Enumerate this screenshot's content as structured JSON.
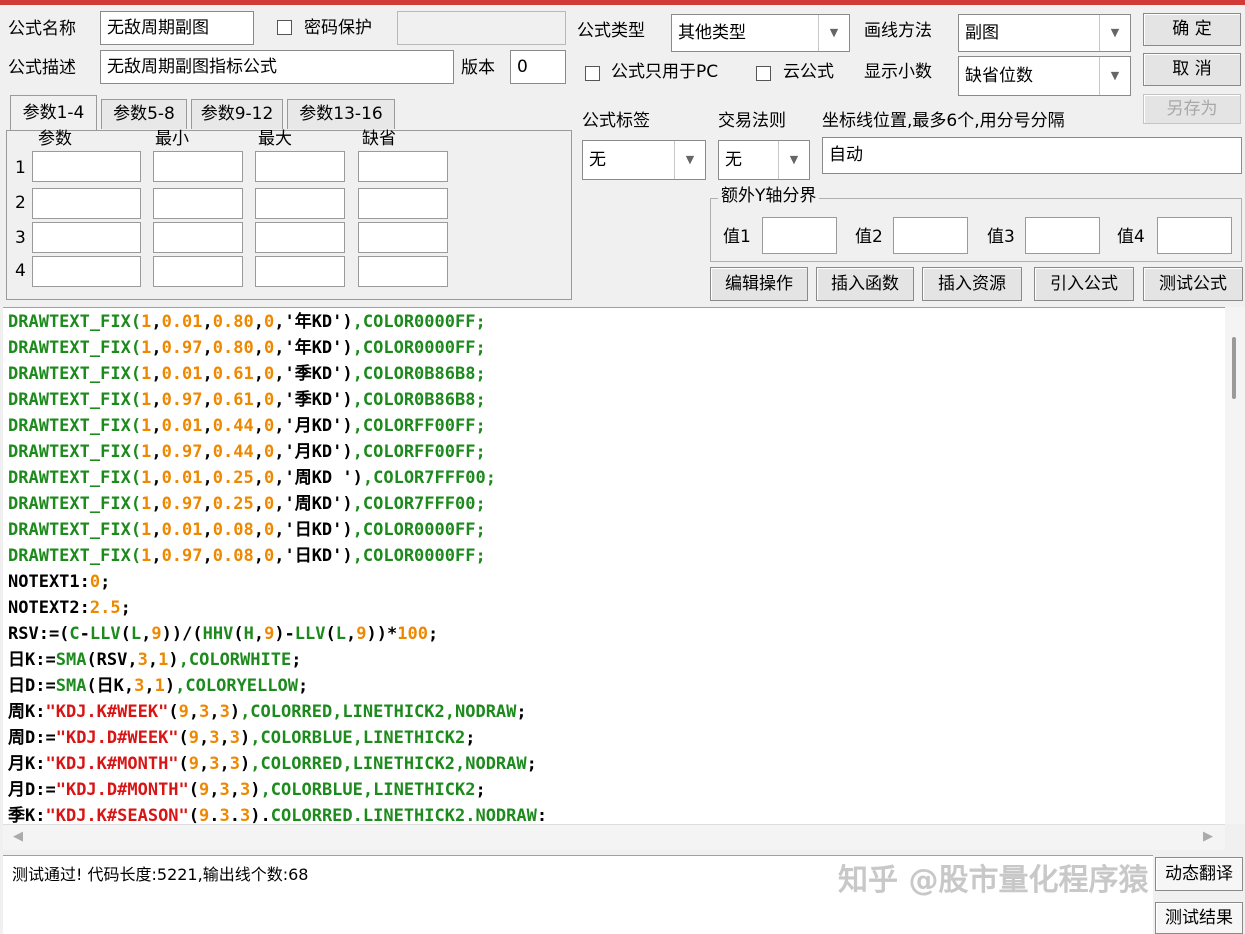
{
  "header": {
    "formula_name_label": "公式名称",
    "formula_name_value": "无敌周期副图",
    "password_label": "密码保护",
    "formula_desc_label": "公式描述",
    "formula_desc_value": "无敌周期副图指标公式",
    "version_label": "版本",
    "version_value": "0",
    "formula_type_label": "公式类型",
    "formula_type_value": "其他类型",
    "draw_method_label": "画线方法",
    "draw_method_value": "副图",
    "pc_only_label": "公式只用于PC",
    "cloud_label": "云公式",
    "decimals_label": "显示小数",
    "decimals_value": "缺省位数"
  },
  "buttons": {
    "ok": "确 定",
    "cancel": "取 消",
    "save_as": "另存为",
    "edit": "编辑操作",
    "insert_func": "插入函数",
    "insert_res": "插入资源",
    "import_formula": "引入公式",
    "test_formula": "测试公式",
    "dynamic_translate": "动态翻译",
    "test_result": "测试结果"
  },
  "params": {
    "tabs": [
      "参数1-4",
      "参数5-8",
      "参数9-12",
      "参数13-16"
    ],
    "columns": [
      "参数",
      "最小",
      "最大",
      "缺省"
    ],
    "rows": [
      "1",
      "2",
      "3",
      "4"
    ]
  },
  "options": {
    "formula_tag_label": "公式标签",
    "formula_tag_value": "无",
    "trade_rule_label": "交易法则",
    "trade_rule_value": "无",
    "coord_label": "坐标线位置,最多6个,用分号分隔",
    "coord_value": "自动",
    "y_group_label": "额外Y轴分界",
    "y_values": [
      "值1",
      "值2",
      "值3",
      "值4"
    ]
  },
  "code_lines": [
    [
      [
        "g",
        "DRAWTEXT_FIX("
      ],
      [
        "o",
        "1"
      ],
      [
        "k",
        ","
      ],
      [
        "o",
        "0.01"
      ],
      [
        "k",
        ","
      ],
      [
        "o",
        "0.80"
      ],
      [
        "k",
        ","
      ],
      [
        "o",
        "0"
      ],
      [
        "k",
        ",'年KD')"
      ],
      [
        "g",
        ",COLOR0000FF;"
      ]
    ],
    [
      [
        "g",
        "DRAWTEXT_FIX("
      ],
      [
        "o",
        "1"
      ],
      [
        "k",
        ","
      ],
      [
        "o",
        "0.97"
      ],
      [
        "k",
        ","
      ],
      [
        "o",
        "0.80"
      ],
      [
        "k",
        ","
      ],
      [
        "o",
        "0"
      ],
      [
        "k",
        ",'年KD')"
      ],
      [
        "g",
        ",COLOR0000FF;"
      ]
    ],
    [
      [
        "g",
        "DRAWTEXT_FIX("
      ],
      [
        "o",
        "1"
      ],
      [
        "k",
        ","
      ],
      [
        "o",
        "0.01"
      ],
      [
        "k",
        ","
      ],
      [
        "o",
        "0.61"
      ],
      [
        "k",
        ","
      ],
      [
        "o",
        "0"
      ],
      [
        "k",
        ",'季KD')"
      ],
      [
        "g",
        ",COLOR0B86B8;"
      ]
    ],
    [
      [
        "g",
        "DRAWTEXT_FIX("
      ],
      [
        "o",
        "1"
      ],
      [
        "k",
        ","
      ],
      [
        "o",
        "0.97"
      ],
      [
        "k",
        ","
      ],
      [
        "o",
        "0.61"
      ],
      [
        "k",
        ","
      ],
      [
        "o",
        "0"
      ],
      [
        "k",
        ",'季KD')"
      ],
      [
        "g",
        ",COLOR0B86B8;"
      ]
    ],
    [
      [
        "g",
        "DRAWTEXT_FIX("
      ],
      [
        "o",
        "1"
      ],
      [
        "k",
        ","
      ],
      [
        "o",
        "0.01"
      ],
      [
        "k",
        ","
      ],
      [
        "o",
        "0.44"
      ],
      [
        "k",
        ","
      ],
      [
        "o",
        "0"
      ],
      [
        "k",
        ",'月KD')"
      ],
      [
        "g",
        ",COLORFF00FF;"
      ]
    ],
    [
      [
        "g",
        "DRAWTEXT_FIX("
      ],
      [
        "o",
        "1"
      ],
      [
        "k",
        ","
      ],
      [
        "o",
        "0.97"
      ],
      [
        "k",
        ","
      ],
      [
        "o",
        "0.44"
      ],
      [
        "k",
        ","
      ],
      [
        "o",
        "0"
      ],
      [
        "k",
        ",'月KD')"
      ],
      [
        "g",
        ",COLORFF00FF;"
      ]
    ],
    [
      [
        "g",
        "DRAWTEXT_FIX("
      ],
      [
        "o",
        "1"
      ],
      [
        "k",
        ","
      ],
      [
        "o",
        "0.01"
      ],
      [
        "k",
        ","
      ],
      [
        "o",
        "0.25"
      ],
      [
        "k",
        ","
      ],
      [
        "o",
        "0"
      ],
      [
        "k",
        ",'周KD ')"
      ],
      [
        "g",
        ",COLOR7FFF00;"
      ]
    ],
    [
      [
        "g",
        "DRAWTEXT_FIX("
      ],
      [
        "o",
        "1"
      ],
      [
        "k",
        ","
      ],
      [
        "o",
        "0.97"
      ],
      [
        "k",
        ","
      ],
      [
        "o",
        "0.25"
      ],
      [
        "k",
        ","
      ],
      [
        "o",
        "0"
      ],
      [
        "k",
        ",'周KD')"
      ],
      [
        "g",
        ",COLOR7FFF00;"
      ]
    ],
    [
      [
        "g",
        "DRAWTEXT_FIX("
      ],
      [
        "o",
        "1"
      ],
      [
        "k",
        ","
      ],
      [
        "o",
        "0.01"
      ],
      [
        "k",
        ","
      ],
      [
        "o",
        "0.08"
      ],
      [
        "k",
        ","
      ],
      [
        "o",
        "0"
      ],
      [
        "k",
        ",'日KD')"
      ],
      [
        "g",
        ",COLOR0000FF;"
      ]
    ],
    [
      [
        "g",
        "DRAWTEXT_FIX("
      ],
      [
        "o",
        "1"
      ],
      [
        "k",
        ","
      ],
      [
        "o",
        "0.97"
      ],
      [
        "k",
        ","
      ],
      [
        "o",
        "0.08"
      ],
      [
        "k",
        ","
      ],
      [
        "o",
        "0"
      ],
      [
        "k",
        ",'日KD')"
      ],
      [
        "g",
        ",COLOR0000FF;"
      ]
    ],
    [
      [
        "k",
        "NOTEXT1:"
      ],
      [
        "o",
        "0"
      ],
      [
        "k",
        ";"
      ]
    ],
    [
      [
        "k",
        "NOTEXT2:"
      ],
      [
        "o",
        "2.5"
      ],
      [
        "k",
        ";"
      ]
    ],
    [
      [
        "k",
        "RSV:=("
      ],
      [
        "g",
        "C"
      ],
      [
        "k",
        "-"
      ],
      [
        "g",
        "LLV"
      ],
      [
        "k",
        "("
      ],
      [
        "g",
        "L"
      ],
      [
        "k",
        ","
      ],
      [
        "o",
        "9"
      ],
      [
        "k",
        "))/("
      ],
      [
        "g",
        "HHV"
      ],
      [
        "k",
        "("
      ],
      [
        "g",
        "H"
      ],
      [
        "k",
        ","
      ],
      [
        "o",
        "9"
      ],
      [
        "k",
        ")-"
      ],
      [
        "g",
        "LLV"
      ],
      [
        "k",
        "("
      ],
      [
        "g",
        "L"
      ],
      [
        "k",
        ","
      ],
      [
        "o",
        "9"
      ],
      [
        "k",
        "))*"
      ],
      [
        "o",
        "100"
      ],
      [
        "k",
        ";"
      ]
    ],
    [
      [
        "k",
        "日K:="
      ],
      [
        "g",
        "SMA"
      ],
      [
        "k",
        "(RSV,"
      ],
      [
        "o",
        "3"
      ],
      [
        "k",
        ","
      ],
      [
        "o",
        "1"
      ],
      [
        "k",
        ")"
      ],
      [
        "g",
        ",COLORWHITE"
      ],
      [
        "k",
        ";"
      ]
    ],
    [
      [
        "k",
        "日D:="
      ],
      [
        "g",
        "SMA"
      ],
      [
        "k",
        "(日K,"
      ],
      [
        "o",
        "3"
      ],
      [
        "k",
        ","
      ],
      [
        "o",
        "1"
      ],
      [
        "k",
        ")"
      ],
      [
        "g",
        ",COLORYELLOW"
      ],
      [
        "k",
        ";"
      ]
    ],
    [
      [
        "k",
        "周K:"
      ],
      [
        "r",
        "\"KDJ.K#WEEK\""
      ],
      [
        "k",
        "("
      ],
      [
        "o",
        "9"
      ],
      [
        "k",
        ","
      ],
      [
        "o",
        "3"
      ],
      [
        "k",
        ","
      ],
      [
        "o",
        "3"
      ],
      [
        "k",
        ")"
      ],
      [
        "g",
        ",COLORRED,LINETHICK2,NODRAW"
      ],
      [
        "k",
        ";"
      ]
    ],
    [
      [
        "k",
        "周D:="
      ],
      [
        "r",
        "\"KDJ.D#WEEK\""
      ],
      [
        "k",
        "("
      ],
      [
        "o",
        "9"
      ],
      [
        "k",
        ","
      ],
      [
        "o",
        "3"
      ],
      [
        "k",
        ","
      ],
      [
        "o",
        "3"
      ],
      [
        "k",
        ")"
      ],
      [
        "g",
        ",COLORBLUE,LINETHICK2"
      ],
      [
        "k",
        ";"
      ]
    ],
    [
      [
        "k",
        "月K:"
      ],
      [
        "r",
        "\"KDJ.K#MONTH\""
      ],
      [
        "k",
        "("
      ],
      [
        "o",
        "9"
      ],
      [
        "k",
        ","
      ],
      [
        "o",
        "3"
      ],
      [
        "k",
        ","
      ],
      [
        "o",
        "3"
      ],
      [
        "k",
        ")"
      ],
      [
        "g",
        ",COLORRED,LINETHICK2,NODRAW"
      ],
      [
        "k",
        ";"
      ]
    ],
    [
      [
        "k",
        "月D:="
      ],
      [
        "r",
        "\"KDJ.D#MONTH\""
      ],
      [
        "k",
        "("
      ],
      [
        "o",
        "9"
      ],
      [
        "k",
        ","
      ],
      [
        "o",
        "3"
      ],
      [
        "k",
        ","
      ],
      [
        "o",
        "3"
      ],
      [
        "k",
        ")"
      ],
      [
        "g",
        ",COLORBLUE,LINETHICK2"
      ],
      [
        "k",
        ";"
      ]
    ],
    [
      [
        "k",
        "季K:"
      ],
      [
        "r",
        "\"KDJ.K#SEASON\""
      ],
      [
        "k",
        "("
      ],
      [
        "o",
        "9"
      ],
      [
        "k",
        "."
      ],
      [
        "o",
        "3"
      ],
      [
        "k",
        "."
      ],
      [
        "o",
        "3"
      ],
      [
        "k",
        ")."
      ],
      [
        "g",
        "COLORRED.LINETHICK2.NODRAW"
      ],
      [
        "k",
        ":"
      ]
    ]
  ],
  "status": {
    "text": "测试通过! 代码长度:5221,输出线个数:68",
    "watermark": "知乎 @股市量化程序猿"
  }
}
